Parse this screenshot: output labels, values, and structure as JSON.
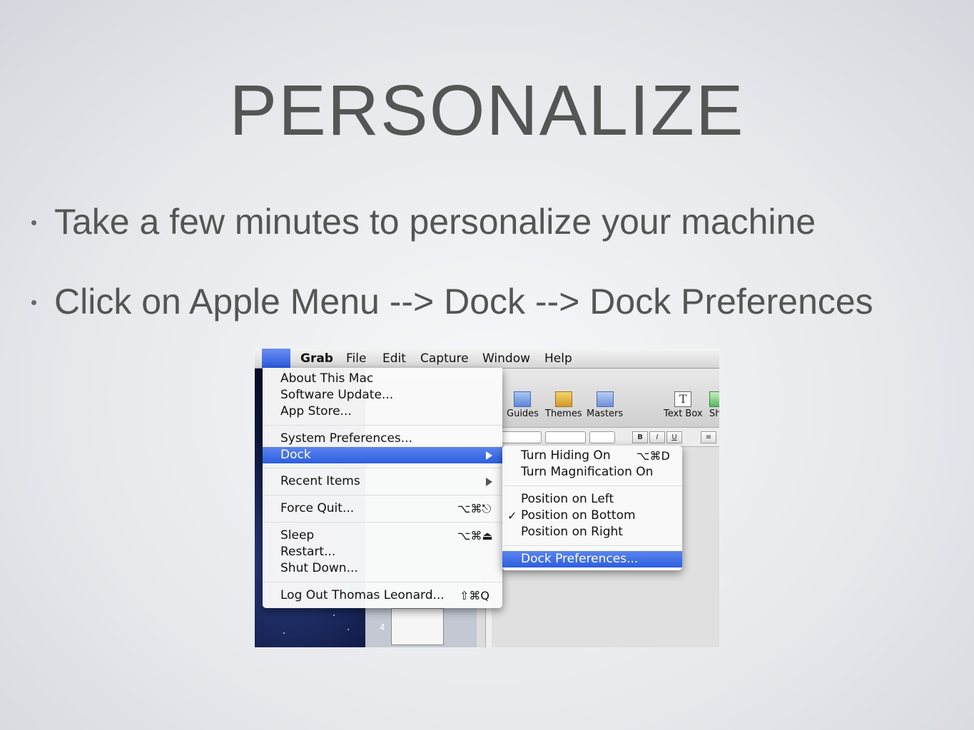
{
  "slide": {
    "title": "PERSONALIZE",
    "bullets": [
      "Take a few minutes to personalize your machine",
      "Click on Apple Menu --> Dock --> Dock Preferences"
    ]
  },
  "menubar": {
    "apple_icon": "",
    "items": [
      "Grab",
      "File",
      "Edit",
      "Capture",
      "Window",
      "Help"
    ]
  },
  "toolbar": {
    "tools": [
      "Guides",
      "Themes",
      "Masters",
      "Text Box",
      "Sh"
    ],
    "format_buttons": [
      "B",
      "I",
      "U"
    ]
  },
  "sidebar": {
    "slide_number": "4"
  },
  "apple_menu": {
    "about": "About This Mac",
    "software_update": "Software Update...",
    "app_store": "App Store...",
    "system_preferences": "System Preferences...",
    "dock": "Dock",
    "recent_items": "Recent Items",
    "force_quit": "Force Quit...",
    "force_quit_shortcut": "⌥⌘⎋",
    "sleep": "Sleep",
    "sleep_shortcut": "⌥⌘⏏",
    "restart": "Restart...",
    "shut_down": "Shut Down...",
    "log_out": "Log Out Thomas Leonard...",
    "log_out_shortcut": "⇧⌘Q"
  },
  "dock_menu": {
    "turn_hiding_on": "Turn Hiding On",
    "turn_hiding_shortcut": "⌥⌘D",
    "turn_magnification_on": "Turn Magnification On",
    "position_left": "Position on Left",
    "position_bottom": "Position on Bottom",
    "position_right": "Position on Right",
    "checkmark": "✓",
    "dock_preferences": "Dock Preferences..."
  },
  "colors": {
    "highlight": "#3d6be6",
    "title_text": "#555555"
  }
}
